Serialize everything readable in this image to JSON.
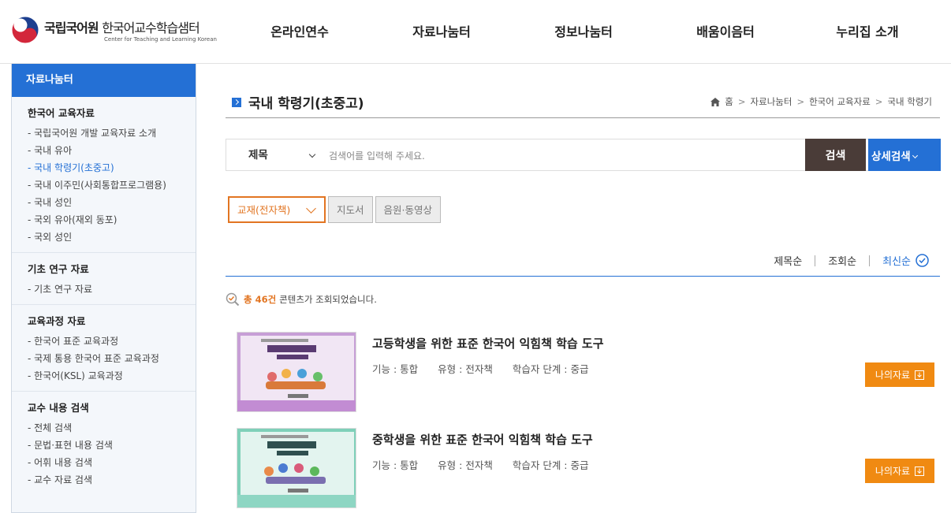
{
  "header": {
    "logo_main": "국립국어원",
    "logo_main2": "한국어교수학습샘터",
    "logo_sub": "Center for Teaching and Learning Korean",
    "nav": [
      "온라인연수",
      "자료나눔터",
      "정보나눔터",
      "배움이음터",
      "누리집 소개"
    ]
  },
  "sidebar": {
    "title": "자료나눔터",
    "groups": [
      {
        "heading": "한국어 교육자료",
        "items": [
          "- 국립국어원 개발 교육자료 소개",
          "- 국내 유아",
          "- 국내 학령기(초중고)",
          "- 국내 이주민(사회통합프로그램용)",
          "- 국내 성인",
          "- 국외 유아(재외 동포)",
          "- 국외 성인"
        ]
      },
      {
        "heading": "기초 연구 자료",
        "items": [
          "- 기초 연구 자료"
        ]
      },
      {
        "heading": "교육과정 자료",
        "items": [
          "- 한국어 표준 교육과정",
          "- 국제 통용 한국어 표준 교육과정",
          "- 한국어(KSL) 교육과정"
        ]
      },
      {
        "heading": "교수 내용 검색",
        "items": [
          "- 전체 검색",
          "- 문법·표현 내용 검색",
          "- 어휘 내용 검색",
          "- 교수 자료 검색"
        ]
      }
    ]
  },
  "main": {
    "title": "국내 학령기(초중고)",
    "breadcrumb": [
      "홈",
      "자료나눔터",
      "한국어 교육자료",
      "국내 학령기"
    ],
    "search": {
      "field": "제목",
      "placeholder": "검색어를 입력해 주세요.",
      "search_label": "검색",
      "detail_label": "상세검색"
    },
    "tabs": [
      "교재(전자책)",
      "지도서",
      "음원·동영상"
    ],
    "sort": [
      "제목순",
      "조회순",
      "최신순"
    ],
    "count_num": "총 46건",
    "count_text": "콘텐츠가 조회되었습니다.",
    "items": [
      {
        "title": "고등학생을 위한 표준 한국어 익힘책 학습 도구",
        "func": "기능 : 통합",
        "type": "유형 : 전자책",
        "level": "학습자 단계 : 중급",
        "button": "나의자료"
      },
      {
        "title": "중학생을 위한 표준 한국어 익힘책 학습 도구",
        "func": "기능 : 통합",
        "type": "유형 : 전자책",
        "level": "학습자 단계 : 중급",
        "button": "나의자료"
      }
    ]
  },
  "colors": {
    "brand_blue": "#2470d5",
    "orange": "#f08a12",
    "dark_button": "#4a3c38"
  }
}
